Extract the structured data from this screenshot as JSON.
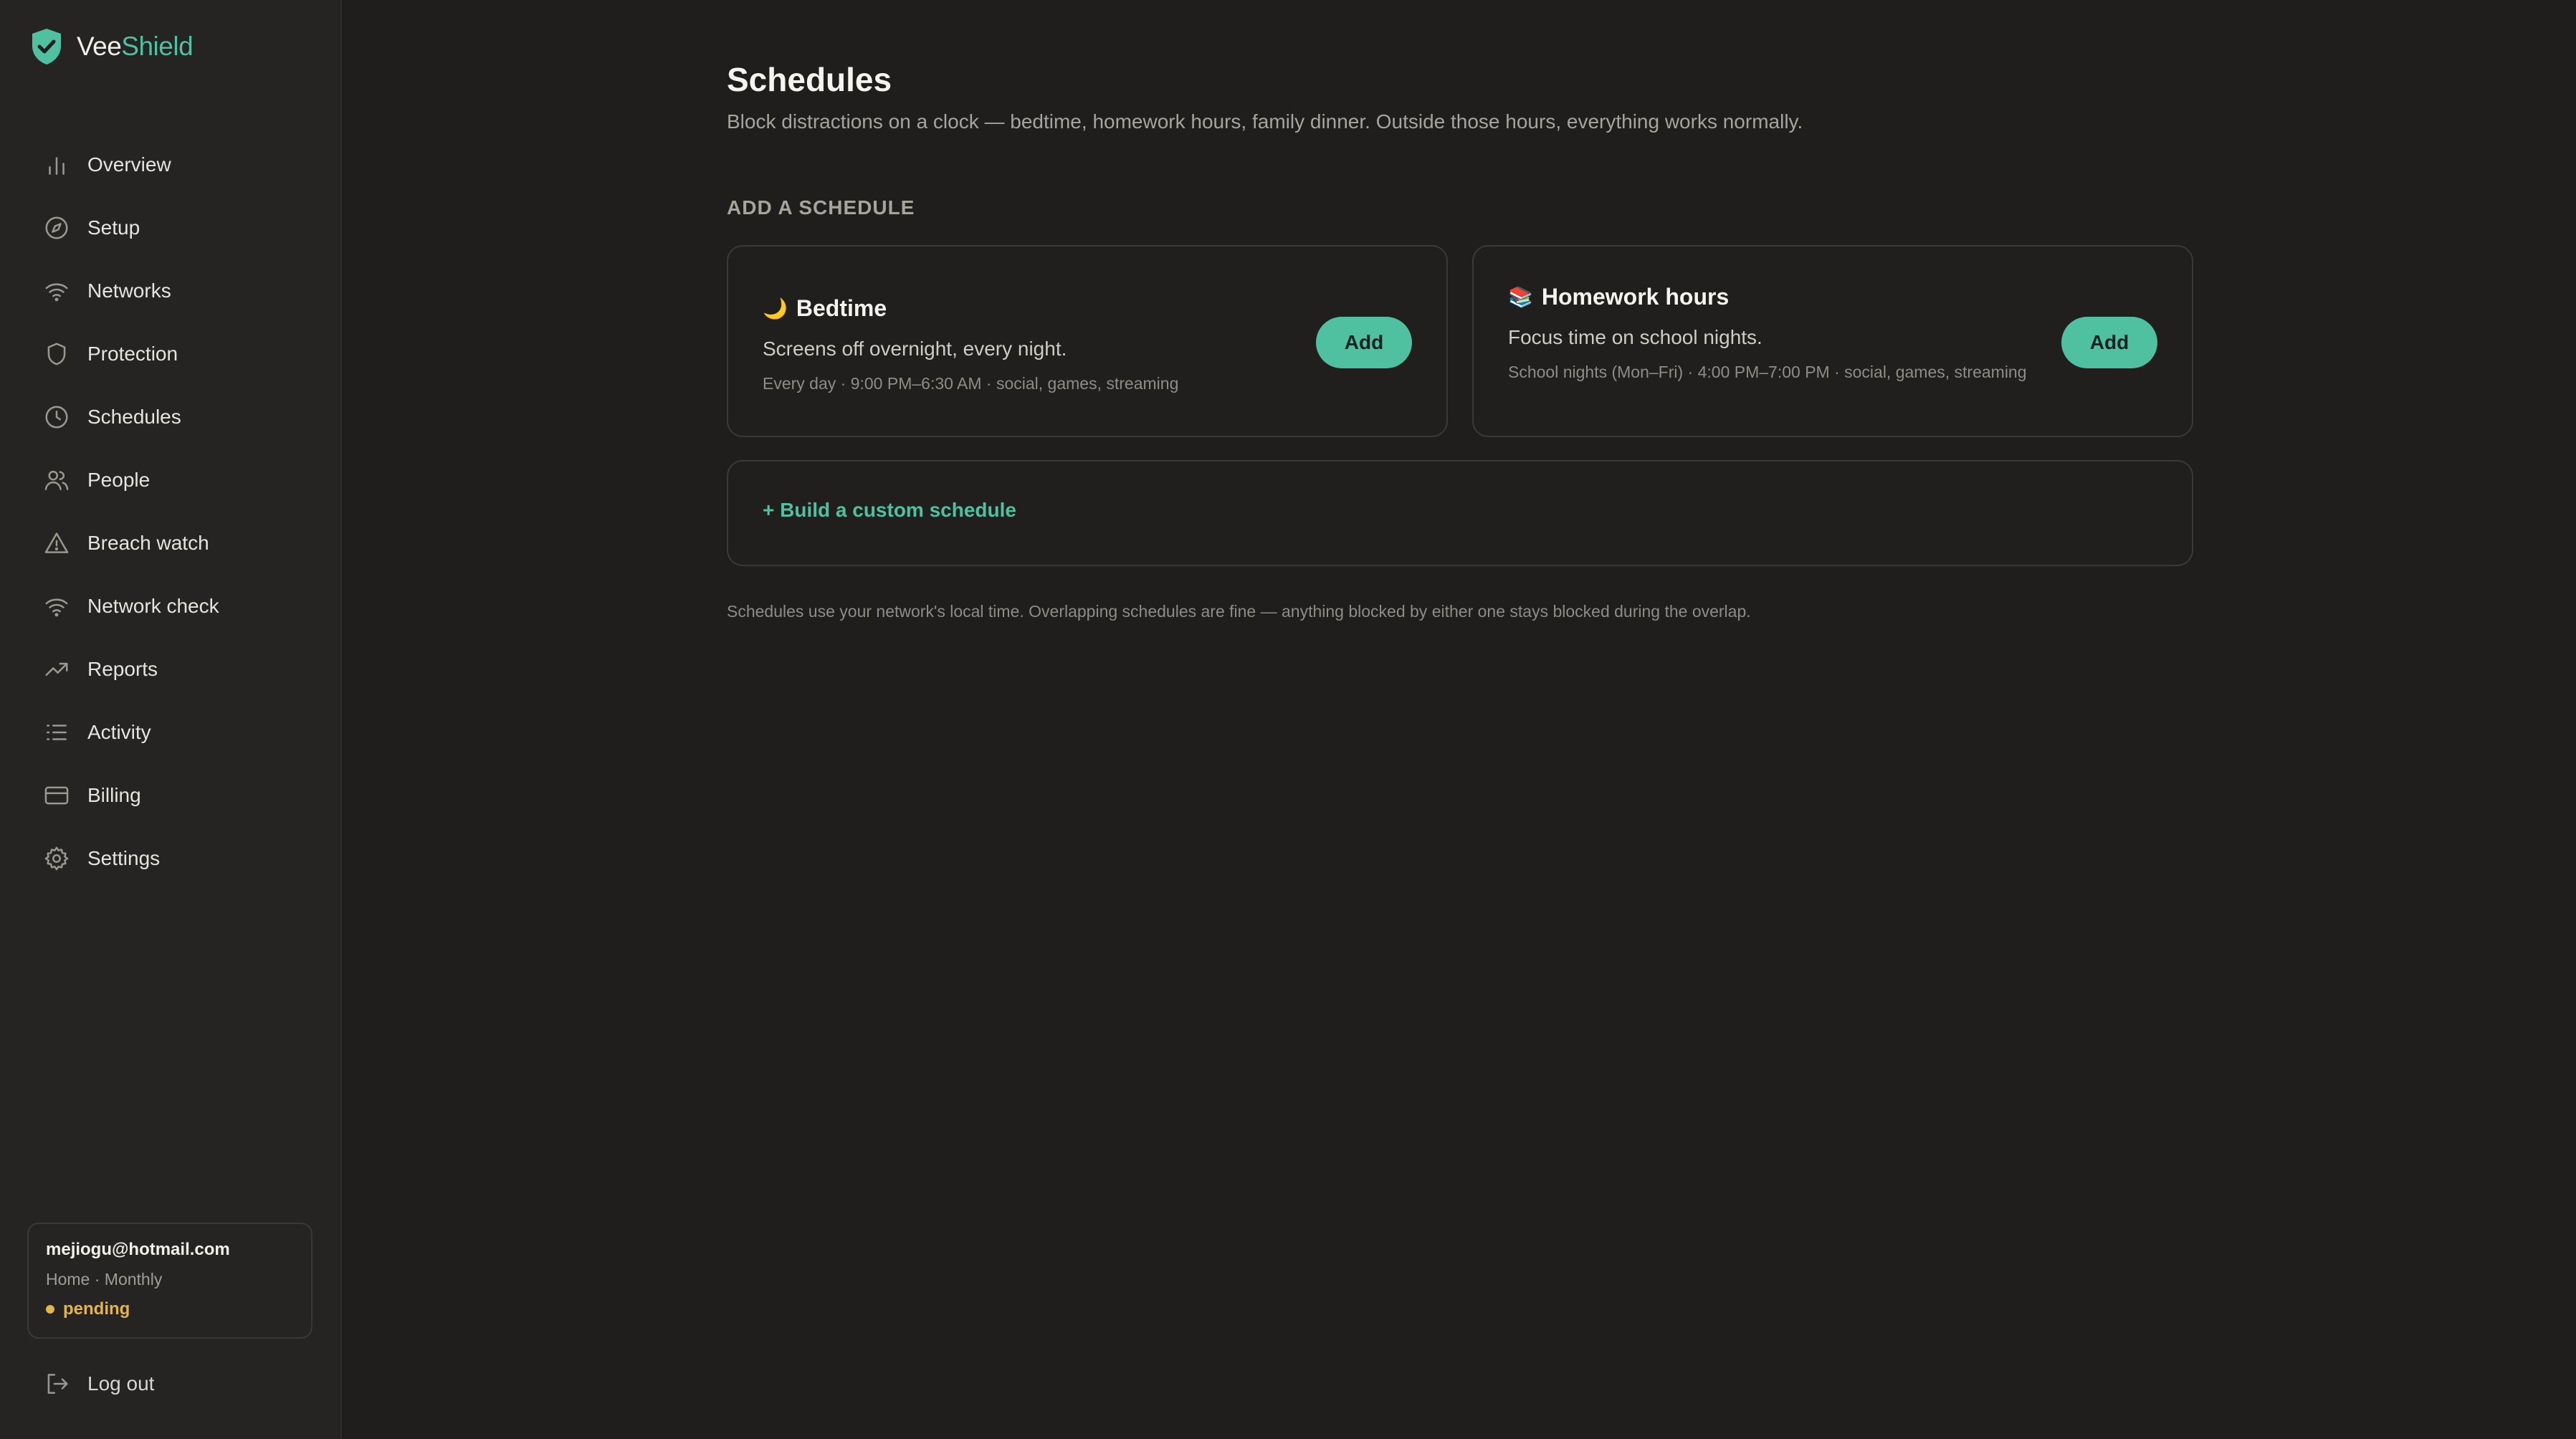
{
  "brand": {
    "name_part1": "Vee",
    "name_part2": "Shield",
    "accent_color": "#4fc0a0"
  },
  "sidebar": {
    "items": [
      {
        "label": "Overview",
        "icon": "bar-chart-icon"
      },
      {
        "label": "Setup",
        "icon": "compass-icon"
      },
      {
        "label": "Networks",
        "icon": "wifi-icon"
      },
      {
        "label": "Protection",
        "icon": "shield-icon"
      },
      {
        "label": "Schedules",
        "icon": "clock-icon"
      },
      {
        "label": "People",
        "icon": "users-icon"
      },
      {
        "label": "Breach watch",
        "icon": "warning-icon"
      },
      {
        "label": "Network check",
        "icon": "wifi-icon"
      },
      {
        "label": "Reports",
        "icon": "trending-up-icon"
      },
      {
        "label": "Activity",
        "icon": "list-icon"
      },
      {
        "label": "Billing",
        "icon": "credit-card-icon"
      },
      {
        "label": "Settings",
        "icon": "gear-icon"
      }
    ],
    "account": {
      "email": "mejiogu@hotmail.com",
      "plan": "Home · Monthly",
      "status": "pending",
      "status_color": "#e3b44d"
    },
    "logout_label": "Log out"
  },
  "main": {
    "title": "Schedules",
    "subtitle": "Block distractions on a clock — bedtime, homework hours, family dinner. Outside those hours, everything works normally.",
    "section_label": "ADD A SCHEDULE",
    "templates": [
      {
        "emoji": "🌙",
        "title": "Bedtime",
        "description": "Screens off overnight, every night.",
        "meta": "Every day · 9:00 PM–6:30 AM · social, games, streaming",
        "button_label": "Add"
      },
      {
        "emoji": "📚",
        "title": "Homework hours",
        "description": "Focus time on school nights.",
        "meta": "School nights (Mon–Fri) · 4:00 PM–7:00 PM · social, games, streaming",
        "button_label": "Add"
      }
    ],
    "custom_link": "+ Build a custom schedule",
    "footnote": "Schedules use your network's local time. Overlapping schedules are fine — anything blocked by either one stays blocked during the overlap."
  }
}
